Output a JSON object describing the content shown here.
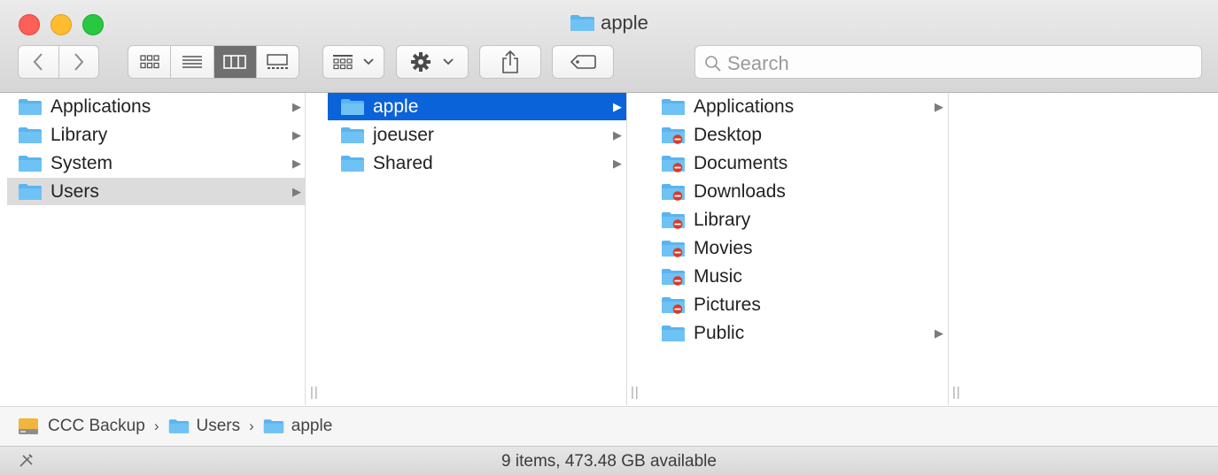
{
  "window": {
    "title": "apple"
  },
  "toolbar": {
    "back_icon": "chevron-left-icon",
    "forward_icon": "chevron-right-icon",
    "view_modes": [
      "icon-view",
      "list-view",
      "column-view",
      "gallery-view"
    ],
    "active_view": "column-view",
    "group_icon": "group-by-icon",
    "action_icon": "gear-icon",
    "share_icon": "share-icon",
    "tag_icon": "tag-icon"
  },
  "search": {
    "placeholder": "Search"
  },
  "columns": [
    {
      "items": [
        {
          "label": "Applications",
          "has_children": true
        },
        {
          "label": "Library",
          "has_children": true
        },
        {
          "label": "System",
          "has_children": true
        },
        {
          "label": "Users",
          "has_children": true,
          "selected": "inactive"
        }
      ]
    },
    {
      "items": [
        {
          "label": "apple",
          "has_children": true,
          "selected": "active"
        },
        {
          "label": "joeuser",
          "has_children": true
        },
        {
          "label": "Shared",
          "has_children": true
        }
      ]
    },
    {
      "items": [
        {
          "label": "Applications",
          "has_children": true
        },
        {
          "label": "Desktop",
          "restricted": true
        },
        {
          "label": "Documents",
          "restricted": true
        },
        {
          "label": "Downloads",
          "restricted": true
        },
        {
          "label": "Library",
          "restricted": true
        },
        {
          "label": "Movies",
          "restricted": true
        },
        {
          "label": "Music",
          "restricted": true
        },
        {
          "label": "Pictures",
          "restricted": true
        },
        {
          "label": "Public",
          "has_children": true
        }
      ]
    }
  ],
  "pathbar": {
    "items": [
      "CCC Backup",
      "Users",
      "apple"
    ]
  },
  "status": {
    "text": "9 items, 473.48 GB available"
  },
  "colors": {
    "selection": "#0a63d8",
    "folder": "#5ab4ef",
    "restricted": "#d93a2b"
  }
}
